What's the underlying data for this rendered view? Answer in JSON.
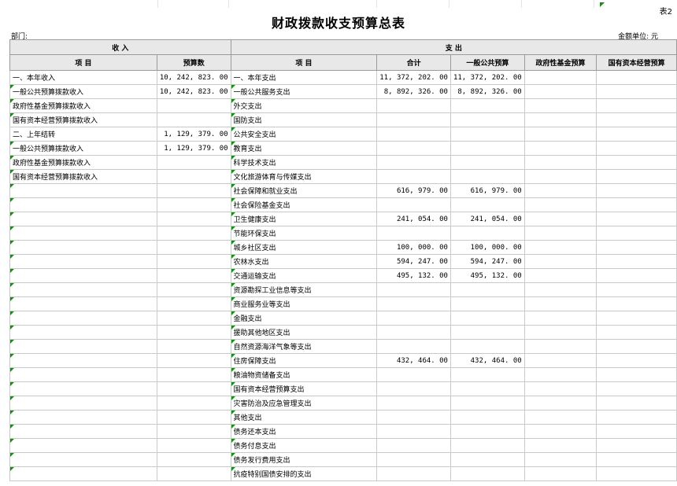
{
  "sheet_no": "表2",
  "title": "财政拨款收支预算总表",
  "dept_label": "部门:",
  "unit_label": "金额单位: 元",
  "headers": {
    "income": "收    入",
    "expense": "支    出",
    "item": "项        目",
    "budget": "预算数",
    "item2": "项        目",
    "total": "合计",
    "general": "一般公共预算",
    "gov_fund": "政府性基金预算",
    "state_capital": "国有资本经营预算"
  },
  "rows": [
    {
      "income_item": "一、本年收入",
      "income_amount": "10, 242, 823. 00",
      "expense_item": "一、本年支出",
      "total": "11, 372, 202. 00",
      "general": "11, 372, 202. 00",
      "gov_fund": "",
      "state_capital": ""
    },
    {
      "income_item": "一般公共预算拨款收入",
      "income_amount": "10, 242, 823. 00",
      "expense_item": "一般公共服务支出",
      "total": "8, 892, 326. 00",
      "general": "8, 892, 326. 00",
      "gov_fund": "",
      "state_capital": ""
    },
    {
      "income_item": "政府性基金预算拨款收入",
      "income_amount": "",
      "expense_item": "外交支出",
      "total": "",
      "general": "",
      "gov_fund": "",
      "state_capital": ""
    },
    {
      "income_item": "国有资本经营预算拨款收入",
      "income_amount": "",
      "expense_item": "国防支出",
      "total": "",
      "general": "",
      "gov_fund": "",
      "state_capital": ""
    },
    {
      "income_item": "二、上年结转",
      "income_amount": "1, 129, 379. 00",
      "expense_item": "公共安全支出",
      "total": "",
      "general": "",
      "gov_fund": "",
      "state_capital": ""
    },
    {
      "income_item": "一般公共预算拨款收入",
      "income_amount": "1, 129, 379. 00",
      "expense_item": "教育支出",
      "total": "",
      "general": "",
      "gov_fund": "",
      "state_capital": ""
    },
    {
      "income_item": "政府性基金预算拨款收入",
      "income_amount": "",
      "expense_item": "科学技术支出",
      "total": "",
      "general": "",
      "gov_fund": "",
      "state_capital": ""
    },
    {
      "income_item": "国有资本经营预算拨款收入",
      "income_amount": "",
      "expense_item": "文化旅游体育与传媒支出",
      "total": "",
      "general": "",
      "gov_fund": "",
      "state_capital": ""
    },
    {
      "income_item": "",
      "income_amount": "",
      "expense_item": "社会保障和就业支出",
      "total": "616, 979. 00",
      "general": "616, 979. 00",
      "gov_fund": "",
      "state_capital": ""
    },
    {
      "income_item": "",
      "income_amount": "",
      "expense_item": "社会保险基金支出",
      "total": "",
      "general": "",
      "gov_fund": "",
      "state_capital": ""
    },
    {
      "income_item": "",
      "income_amount": "",
      "expense_item": "卫生健康支出",
      "total": "241, 054. 00",
      "general": "241, 054. 00",
      "gov_fund": "",
      "state_capital": ""
    },
    {
      "income_item": "",
      "income_amount": "",
      "expense_item": "节能环保支出",
      "total": "",
      "general": "",
      "gov_fund": "",
      "state_capital": ""
    },
    {
      "income_item": "",
      "income_amount": "",
      "expense_item": "城乡社区支出",
      "total": "100, 000. 00",
      "general": "100, 000. 00",
      "gov_fund": "",
      "state_capital": ""
    },
    {
      "income_item": "",
      "income_amount": "",
      "expense_item": "农林水支出",
      "total": "594, 247. 00",
      "general": "594, 247. 00",
      "gov_fund": "",
      "state_capital": ""
    },
    {
      "income_item": "",
      "income_amount": "",
      "expense_item": "交通运输支出",
      "total": "495, 132. 00",
      "general": "495, 132. 00",
      "gov_fund": "",
      "state_capital": ""
    },
    {
      "income_item": "",
      "income_amount": "",
      "expense_item": "资源勘探工业信息等支出",
      "total": "",
      "general": "",
      "gov_fund": "",
      "state_capital": ""
    },
    {
      "income_item": "",
      "income_amount": "",
      "expense_item": "商业服务业等支出",
      "total": "",
      "general": "",
      "gov_fund": "",
      "state_capital": ""
    },
    {
      "income_item": "",
      "income_amount": "",
      "expense_item": "金融支出",
      "total": "",
      "general": "",
      "gov_fund": "",
      "state_capital": ""
    },
    {
      "income_item": "",
      "income_amount": "",
      "expense_item": "援助其他地区支出",
      "total": "",
      "general": "",
      "gov_fund": "",
      "state_capital": ""
    },
    {
      "income_item": "",
      "income_amount": "",
      "expense_item": "自然资源海洋气象等支出",
      "total": "",
      "general": "",
      "gov_fund": "",
      "state_capital": ""
    },
    {
      "income_item": "",
      "income_amount": "",
      "expense_item": "住房保障支出",
      "total": "432, 464. 00",
      "general": "432, 464. 00",
      "gov_fund": "",
      "state_capital": ""
    },
    {
      "income_item": "",
      "income_amount": "",
      "expense_item": "粮油物资储备支出",
      "total": "",
      "general": "",
      "gov_fund": "",
      "state_capital": ""
    },
    {
      "income_item": "",
      "income_amount": "",
      "expense_item": "国有资本经营预算支出",
      "total": "",
      "general": "",
      "gov_fund": "",
      "state_capital": ""
    },
    {
      "income_item": "",
      "income_amount": "",
      "expense_item": "灾害防治及应急管理支出",
      "total": "",
      "general": "",
      "gov_fund": "",
      "state_capital": ""
    },
    {
      "income_item": "",
      "income_amount": "",
      "expense_item": "其他支出",
      "total": "",
      "general": "",
      "gov_fund": "",
      "state_capital": ""
    },
    {
      "income_item": "",
      "income_amount": "",
      "expense_item": "债务还本支出",
      "total": "",
      "general": "",
      "gov_fund": "",
      "state_capital": ""
    },
    {
      "income_item": "",
      "income_amount": "",
      "expense_item": "债务付息支出",
      "total": "",
      "general": "",
      "gov_fund": "",
      "state_capital": ""
    },
    {
      "income_item": "",
      "income_amount": "",
      "expense_item": "债务发行费用支出",
      "total": "",
      "general": "",
      "gov_fund": "",
      "state_capital": ""
    },
    {
      "income_item": "",
      "income_amount": "",
      "expense_item": "抗疫特别国债安排的支出",
      "total": "",
      "general": "",
      "gov_fund": "",
      "state_capital": ""
    }
  ]
}
